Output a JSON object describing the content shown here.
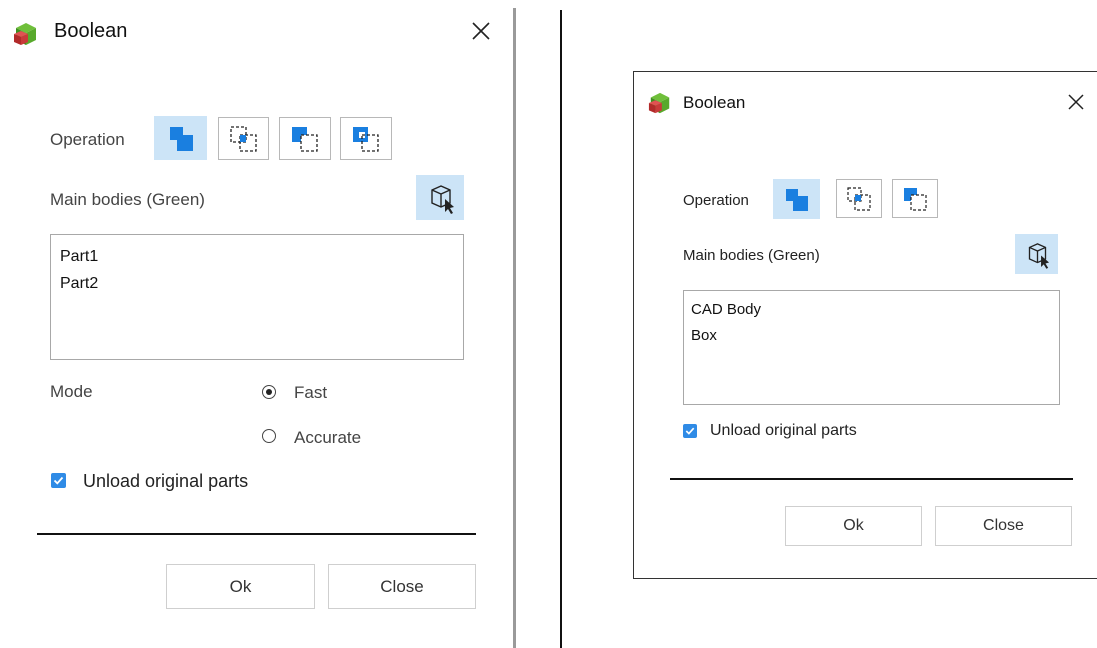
{
  "left_dialog": {
    "title": "Boolean",
    "operation_label": "Operation",
    "main_bodies_label": "Main bodies (Green)",
    "bodies": [
      "Part1",
      "Part2"
    ],
    "mode_label": "Mode",
    "mode_options": [
      "Fast",
      "Accurate"
    ],
    "selected_mode": "Fast",
    "unload_label": "Unload original parts",
    "unload_checked": true,
    "ok_label": "Ok",
    "close_label": "Close"
  },
  "right_dialog": {
    "title": "Boolean",
    "operation_label": "Operation",
    "main_bodies_label": "Main bodies (Green)",
    "bodies": [
      "CAD Body",
      "Box"
    ],
    "unload_label": "Unload original parts",
    "unload_checked": true,
    "ok_label": "Ok",
    "close_label": "Close"
  },
  "colors": {
    "accent": "#2f8be6",
    "selected_bg": "#cce4f7"
  },
  "icons": {
    "app": "boolean-cubes-icon",
    "close": "close-icon",
    "select": "select-body-icon",
    "ops": [
      "union-icon",
      "intersect-icon",
      "subtract-icon",
      "subtract-keep-icon"
    ]
  }
}
